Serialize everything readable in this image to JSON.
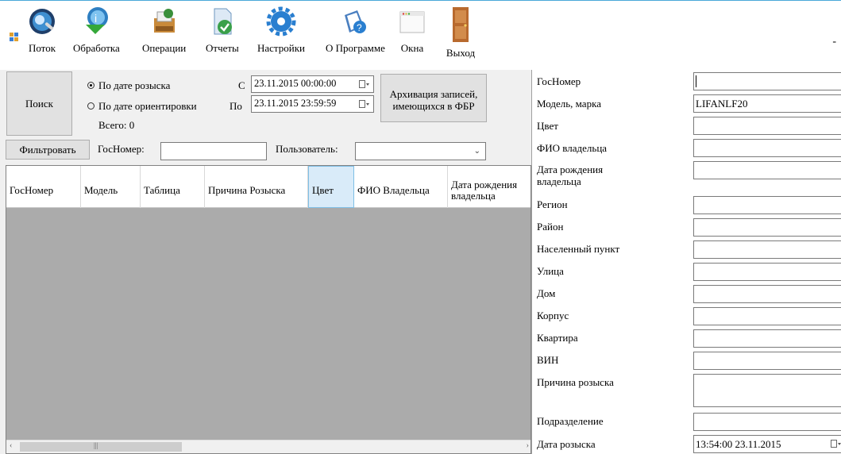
{
  "toolbar": {
    "items": [
      {
        "label": "Поток",
        "icon": "stream-icon"
      },
      {
        "label": "Обработка",
        "icon": "processing-icon"
      },
      {
        "label": "Операции",
        "icon": "operations-icon"
      },
      {
        "label": "Отчеты",
        "icon": "reports-icon"
      },
      {
        "label": "Настройки",
        "icon": "settings-icon"
      },
      {
        "label": "О Программе",
        "icon": "about-icon"
      },
      {
        "label": "Окна",
        "icon": "windows-icon"
      },
      {
        "label": "Выход",
        "icon": "exit-door-icon"
      }
    ],
    "minimize": "-"
  },
  "search": {
    "search_button": "Поиск",
    "radio_search_date": "По дате розыска",
    "radio_orient_date": "По дате ориентировки",
    "radio_selected": "search_date",
    "from_label": "С",
    "to_label": "По",
    "from_value": "23.11.2015 00:00:00",
    "to_value": "23.11.2015 23:59:59",
    "archive_button": "Архивация записей, имеющихся в ФБР",
    "total": "Всего: 0"
  },
  "filter": {
    "filter_button": "Фильтровать",
    "gosnomer_label": "ГосНомер:",
    "gosnomer_value": "",
    "user_label": "Пользователь:",
    "user_value": ""
  },
  "grid": {
    "columns": [
      "ГосНомер",
      "Модель",
      "Таблица",
      "Причина Розыска",
      "Цвет",
      "ФИО Владельца",
      "Дата рождения владельца"
    ],
    "selected_column": "Цвет",
    "rows": []
  },
  "details": {
    "fields": [
      {
        "label": "ГосНомер",
        "value": ""
      },
      {
        "label": "Модель, марка",
        "value": "LIFANLF20"
      },
      {
        "label": "Цвет",
        "value": ""
      },
      {
        "label": "ФИО владельца",
        "value": ""
      },
      {
        "label": "Дата рождения владельца",
        "value": ""
      },
      {
        "label": "Регион",
        "value": ""
      },
      {
        "label": "Район",
        "value": ""
      },
      {
        "label": "Населенный пункт",
        "value": ""
      },
      {
        "label": "Улица",
        "value": ""
      },
      {
        "label": "Дом",
        "value": ""
      },
      {
        "label": "Корпус",
        "value": ""
      },
      {
        "label": "Квартира",
        "value": ""
      },
      {
        "label": "ВИН",
        "value": ""
      },
      {
        "label": "Причина розыска",
        "value": ""
      },
      {
        "label": "Подразделение",
        "value": ""
      },
      {
        "label": "Дата розыска",
        "value": "13:54:00 23.11.2015"
      }
    ]
  },
  "colors": {
    "panel_bg": "#f0f0f0",
    "grid_bg": "#ababab",
    "selected_header": "#d9ebf9",
    "button_bg": "#e1e1e1"
  }
}
